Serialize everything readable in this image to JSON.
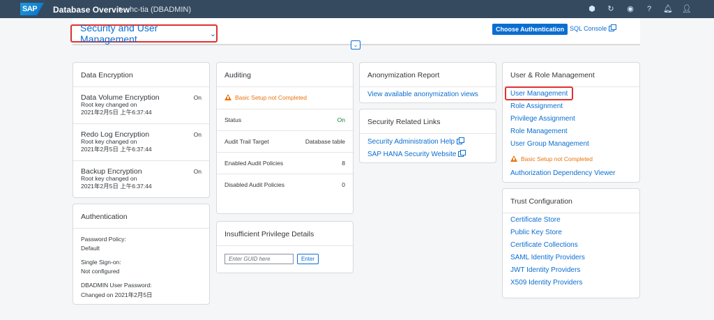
{
  "shell": {
    "logo": "SAP",
    "title": "Database Overview",
    "caret": "▾",
    "subtitle": "hc-tia (DBADMIN)",
    "icons": [
      "cube-icon",
      "refresh-icon",
      "notifications-settings-icon",
      "help-icon",
      "bell-icon",
      "user-icon"
    ]
  },
  "header": {
    "title": "Security and User Management",
    "choose_auth": "Choose Authentication",
    "sql_console": "SQL Console"
  },
  "data_encryption": {
    "title": "Data Encryption",
    "items": [
      {
        "name": "Data Volume Encryption",
        "status": "On",
        "line1": "Root key changed on",
        "line2": "2021年2月5日 上午6:37:44"
      },
      {
        "name": "Redo Log Encryption",
        "status": "On",
        "line1": "Root key changed on",
        "line2": "2021年2月5日 上午6:37:44"
      },
      {
        "name": "Backup Encryption",
        "status": "On",
        "line1": "Root key changed on",
        "line2": "2021年2月5日 上午6:37:44"
      }
    ]
  },
  "authentication": {
    "title": "Authentication",
    "password_policy_label": "Password Policy:",
    "password_policy_value": "Default",
    "sso_label": "Single Sign-on:",
    "sso_value": "Not configured",
    "pwd_label": "DBADMIN User Password:",
    "pwd_value": "Changed on 2021年2月5日"
  },
  "auditing": {
    "title": "Auditing",
    "warning": "Basic Setup not Completed",
    "rows": [
      {
        "label": "Status",
        "value": "On"
      },
      {
        "label": "Audit Trail Target",
        "value": "Database table"
      },
      {
        "label": "Enabled Audit Policies",
        "value": "8"
      },
      {
        "label": "Disabled Audit Policies",
        "value": "0"
      }
    ]
  },
  "insufficient": {
    "title": "Insufficient Privilege Details",
    "placeholder": "Enter GUID here",
    "enter": "Enter"
  },
  "anonymization": {
    "title": "Anonymization Report",
    "link": "View available anonymization views"
  },
  "security_links": {
    "title": "Security Related Links",
    "links": [
      "Security Administration Help",
      "SAP HANA Security Website"
    ]
  },
  "user_role": {
    "title": "User & Role Management",
    "links": [
      "User Management",
      "Role Assignment",
      "Privilege Assignment",
      "Role Management",
      "User Group Management"
    ],
    "warning": "Basic Setup not Completed",
    "last_link": "Authorization Dependency Viewer"
  },
  "trust": {
    "title": "Trust Configuration",
    "links": [
      "Certificate Store",
      "Public Key Store",
      "Certificate Collections",
      "SAML Identity Providers",
      "JWT Identity Providers",
      "X509 Identity Providers"
    ]
  },
  "colors": {
    "shell": "#354a5f",
    "link": "#0a6ed1",
    "warning": "#e9730c",
    "positive": "#107e3e",
    "highlight": "#e0302f"
  }
}
